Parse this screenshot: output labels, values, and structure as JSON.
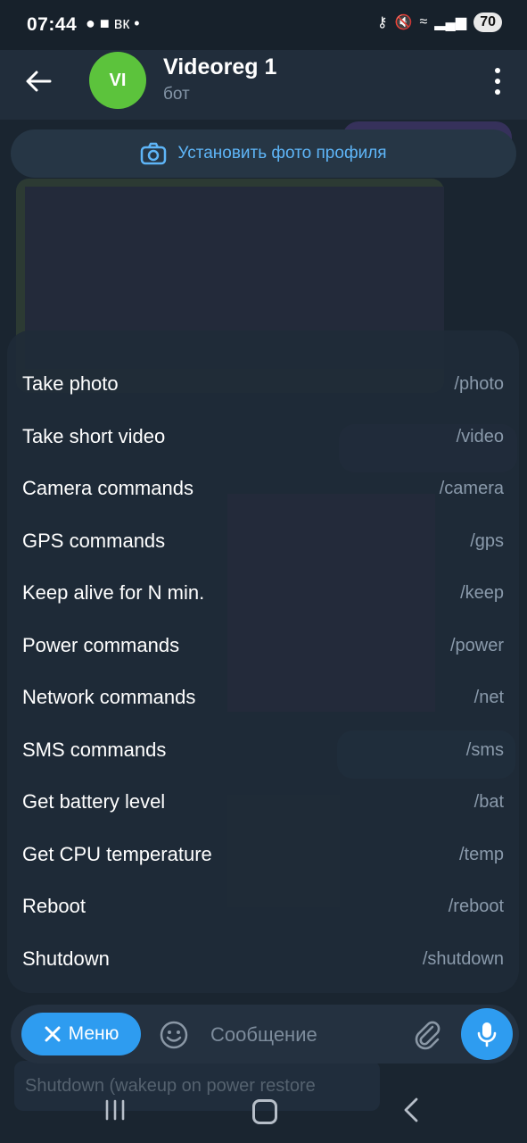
{
  "status_bar": {
    "time": "07:44",
    "left_icons": [
      "chat-icon",
      "bag-icon",
      "vk-icon",
      "dot-icon"
    ],
    "vk_text": "вк",
    "battery": "70"
  },
  "header": {
    "avatar_initials": "VI",
    "title": "Videoreg 1",
    "subtitle": "бот"
  },
  "set_photo": {
    "label": "Установить фото профиля"
  },
  "bot_menu": {
    "items": [
      {
        "name": "Take photo",
        "command": "/photo"
      },
      {
        "name": "Take short video",
        "command": "/video"
      },
      {
        "name": "Camera commands",
        "command": "/camera"
      },
      {
        "name": "GPS commands",
        "command": "/gps"
      },
      {
        "name": "Keep alive for N min.",
        "command": "/keep"
      },
      {
        "name": "Power commands",
        "command": "/power"
      },
      {
        "name": "Network commands",
        "command": "/net"
      },
      {
        "name": "SMS commands",
        "command": "/sms"
      },
      {
        "name": "Get battery level",
        "command": "/bat"
      },
      {
        "name": "Get CPU temperature",
        "command": "/temp"
      },
      {
        "name": "Reboot",
        "command": "/reboot"
      },
      {
        "name": "Shutdown",
        "command": "/shutdown"
      }
    ]
  },
  "input_bar": {
    "menu_label": "Меню",
    "placeholder": "Сообщение"
  },
  "background_message": {
    "text": "Shutdown (wakeup on power restore"
  },
  "colors": {
    "accent": "#2e9cf0",
    "avatar": "#5cc33c",
    "link": "#5eb5f7"
  }
}
